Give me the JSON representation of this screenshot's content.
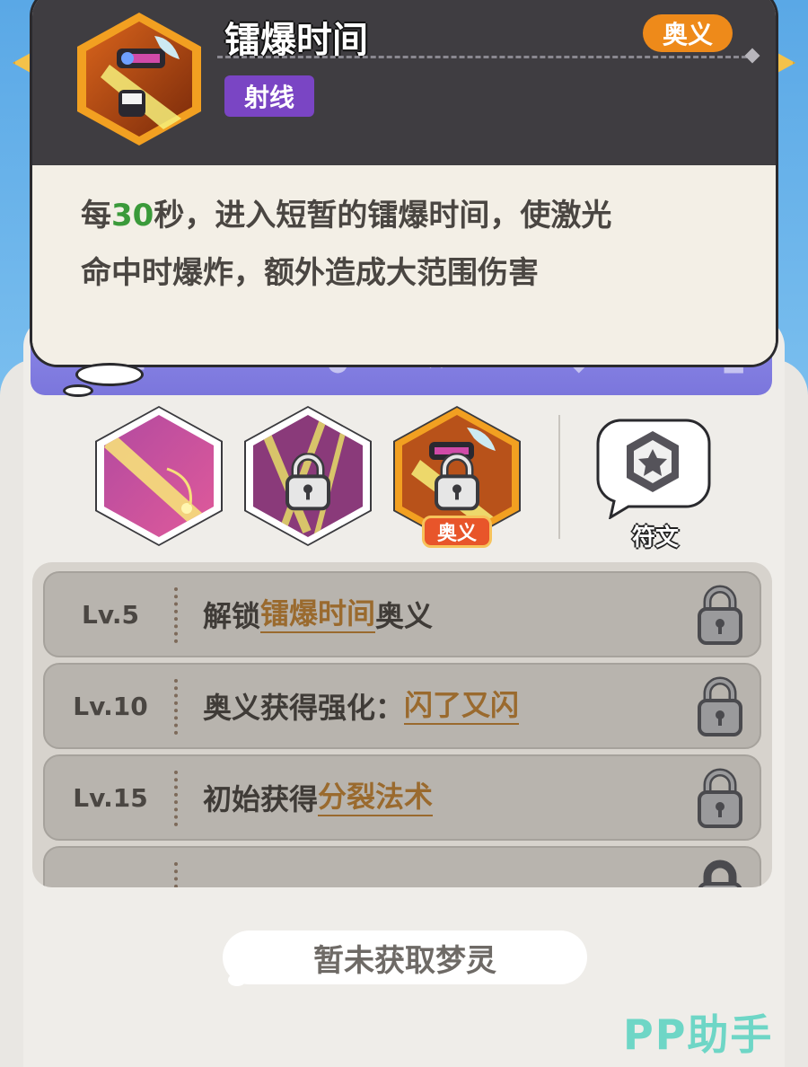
{
  "skill": {
    "title": "镭爆时间",
    "type_badge": "射线",
    "rank_badge": "奥义",
    "description": {
      "prefix": "每",
      "number": "30",
      "rest_line1": "秒，进入短暂的镭爆时间，使激光",
      "line2": "命中时爆炸，额外造成大范围伤害"
    }
  },
  "skill_slots": [
    {
      "name": "slot-1",
      "locked": false
    },
    {
      "name": "slot-2",
      "locked": true
    },
    {
      "name": "slot-3",
      "locked": true,
      "badge": "奥义"
    }
  ],
  "rune": {
    "label": "符文"
  },
  "levels": [
    {
      "level": "Lv.5",
      "pre": "解锁",
      "highlight": "镭爆时间",
      "post": "奥义"
    },
    {
      "level": "Lv.10",
      "pre": "奥义获得强化：",
      "highlight": "闪了又闪",
      "post": ""
    },
    {
      "level": "Lv.15",
      "pre": "初始获得",
      "highlight": "分裂法术",
      "post": ""
    }
  ],
  "footer": {
    "status": "暂未获取梦灵"
  },
  "watermark": "PP助手",
  "colors": {
    "popup_head": "#3f3d41",
    "popup_body": "#f3efe6",
    "type_badge": "#7a45c4",
    "rank_badge": "#ee8a1a",
    "number_green": "#3a9a3a",
    "highlight_brown": "#9a6a2e",
    "watermark": "#6ed6c6"
  }
}
